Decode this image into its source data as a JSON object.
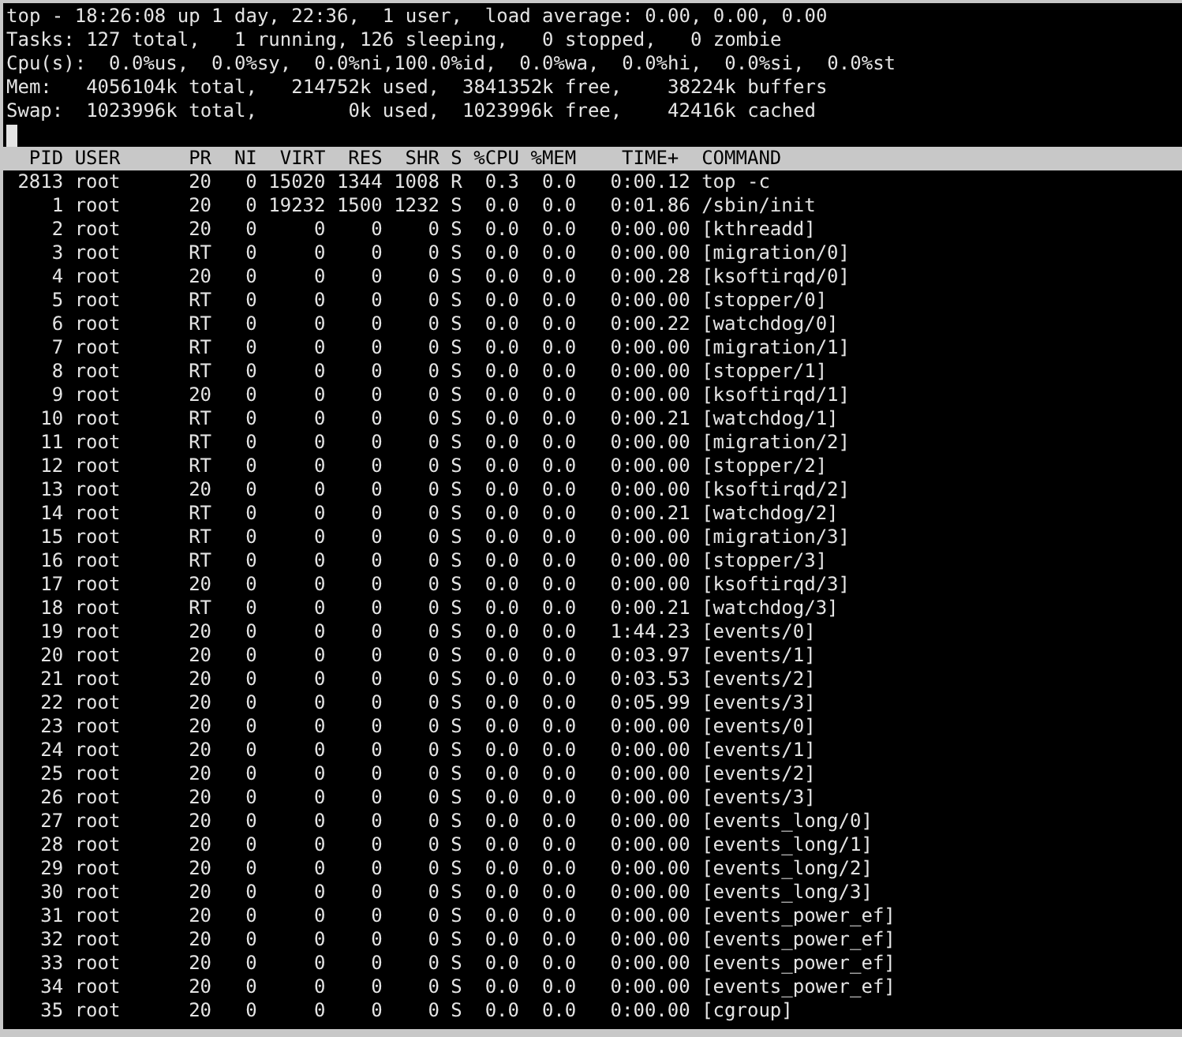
{
  "summary": [
    "top - 18:26:08 up 1 day, 22:36,  1 user,  load average: 0.00, 0.00, 0.00",
    "Tasks: 127 total,   1 running, 126 sleeping,   0 stopped,   0 zombie",
    "Cpu(s):  0.0%us,  0.0%sy,  0.0%ni,100.0%id,  0.0%wa,  0.0%hi,  0.0%si,  0.0%st",
    "Mem:   4056104k total,   214752k used,  3841352k free,    38224k buffers",
    "Swap:  1023996k total,        0k used,  1023996k free,    42416k cached"
  ],
  "columns": [
    "PID",
    "USER",
    "PR",
    "NI",
    "VIRT",
    "RES",
    "SHR",
    "S",
    "%CPU",
    "%MEM",
    "TIME+",
    "COMMAND"
  ],
  "processes": [
    [
      "2813",
      "root",
      "20",
      "0",
      "15020",
      "1344",
      "1008",
      "R",
      "0.3",
      "0.0",
      "0:00.12",
      "top -c"
    ],
    [
      "1",
      "root",
      "20",
      "0",
      "19232",
      "1500",
      "1232",
      "S",
      "0.0",
      "0.0",
      "0:01.86",
      "/sbin/init"
    ],
    [
      "2",
      "root",
      "20",
      "0",
      "0",
      "0",
      "0",
      "S",
      "0.0",
      "0.0",
      "0:00.00",
      "[kthreadd]"
    ],
    [
      "3",
      "root",
      "RT",
      "0",
      "0",
      "0",
      "0",
      "S",
      "0.0",
      "0.0",
      "0:00.00",
      "[migration/0]"
    ],
    [
      "4",
      "root",
      "20",
      "0",
      "0",
      "0",
      "0",
      "S",
      "0.0",
      "0.0",
      "0:00.28",
      "[ksoftirqd/0]"
    ],
    [
      "5",
      "root",
      "RT",
      "0",
      "0",
      "0",
      "0",
      "S",
      "0.0",
      "0.0",
      "0:00.00",
      "[stopper/0]"
    ],
    [
      "6",
      "root",
      "RT",
      "0",
      "0",
      "0",
      "0",
      "S",
      "0.0",
      "0.0",
      "0:00.22",
      "[watchdog/0]"
    ],
    [
      "7",
      "root",
      "RT",
      "0",
      "0",
      "0",
      "0",
      "S",
      "0.0",
      "0.0",
      "0:00.00",
      "[migration/1]"
    ],
    [
      "8",
      "root",
      "RT",
      "0",
      "0",
      "0",
      "0",
      "S",
      "0.0",
      "0.0",
      "0:00.00",
      "[stopper/1]"
    ],
    [
      "9",
      "root",
      "20",
      "0",
      "0",
      "0",
      "0",
      "S",
      "0.0",
      "0.0",
      "0:00.00",
      "[ksoftirqd/1]"
    ],
    [
      "10",
      "root",
      "RT",
      "0",
      "0",
      "0",
      "0",
      "S",
      "0.0",
      "0.0",
      "0:00.21",
      "[watchdog/1]"
    ],
    [
      "11",
      "root",
      "RT",
      "0",
      "0",
      "0",
      "0",
      "S",
      "0.0",
      "0.0",
      "0:00.00",
      "[migration/2]"
    ],
    [
      "12",
      "root",
      "RT",
      "0",
      "0",
      "0",
      "0",
      "S",
      "0.0",
      "0.0",
      "0:00.00",
      "[stopper/2]"
    ],
    [
      "13",
      "root",
      "20",
      "0",
      "0",
      "0",
      "0",
      "S",
      "0.0",
      "0.0",
      "0:00.00",
      "[ksoftirqd/2]"
    ],
    [
      "14",
      "root",
      "RT",
      "0",
      "0",
      "0",
      "0",
      "S",
      "0.0",
      "0.0",
      "0:00.21",
      "[watchdog/2]"
    ],
    [
      "15",
      "root",
      "RT",
      "0",
      "0",
      "0",
      "0",
      "S",
      "0.0",
      "0.0",
      "0:00.00",
      "[migration/3]"
    ],
    [
      "16",
      "root",
      "RT",
      "0",
      "0",
      "0",
      "0",
      "S",
      "0.0",
      "0.0",
      "0:00.00",
      "[stopper/3]"
    ],
    [
      "17",
      "root",
      "20",
      "0",
      "0",
      "0",
      "0",
      "S",
      "0.0",
      "0.0",
      "0:00.00",
      "[ksoftirqd/3]"
    ],
    [
      "18",
      "root",
      "RT",
      "0",
      "0",
      "0",
      "0",
      "S",
      "0.0",
      "0.0",
      "0:00.21",
      "[watchdog/3]"
    ],
    [
      "19",
      "root",
      "20",
      "0",
      "0",
      "0",
      "0",
      "S",
      "0.0",
      "0.0",
      "1:44.23",
      "[events/0]"
    ],
    [
      "20",
      "root",
      "20",
      "0",
      "0",
      "0",
      "0",
      "S",
      "0.0",
      "0.0",
      "0:03.97",
      "[events/1]"
    ],
    [
      "21",
      "root",
      "20",
      "0",
      "0",
      "0",
      "0",
      "S",
      "0.0",
      "0.0",
      "0:03.53",
      "[events/2]"
    ],
    [
      "22",
      "root",
      "20",
      "0",
      "0",
      "0",
      "0",
      "S",
      "0.0",
      "0.0",
      "0:05.99",
      "[events/3]"
    ],
    [
      "23",
      "root",
      "20",
      "0",
      "0",
      "0",
      "0",
      "S",
      "0.0",
      "0.0",
      "0:00.00",
      "[events/0]"
    ],
    [
      "24",
      "root",
      "20",
      "0",
      "0",
      "0",
      "0",
      "S",
      "0.0",
      "0.0",
      "0:00.00",
      "[events/1]"
    ],
    [
      "25",
      "root",
      "20",
      "0",
      "0",
      "0",
      "0",
      "S",
      "0.0",
      "0.0",
      "0:00.00",
      "[events/2]"
    ],
    [
      "26",
      "root",
      "20",
      "0",
      "0",
      "0",
      "0",
      "S",
      "0.0",
      "0.0",
      "0:00.00",
      "[events/3]"
    ],
    [
      "27",
      "root",
      "20",
      "0",
      "0",
      "0",
      "0",
      "S",
      "0.0",
      "0.0",
      "0:00.00",
      "[events_long/0]"
    ],
    [
      "28",
      "root",
      "20",
      "0",
      "0",
      "0",
      "0",
      "S",
      "0.0",
      "0.0",
      "0:00.00",
      "[events_long/1]"
    ],
    [
      "29",
      "root",
      "20",
      "0",
      "0",
      "0",
      "0",
      "S",
      "0.0",
      "0.0",
      "0:00.00",
      "[events_long/2]"
    ],
    [
      "30",
      "root",
      "20",
      "0",
      "0",
      "0",
      "0",
      "S",
      "0.0",
      "0.0",
      "0:00.00",
      "[events_long/3]"
    ],
    [
      "31",
      "root",
      "20",
      "0",
      "0",
      "0",
      "0",
      "S",
      "0.0",
      "0.0",
      "0:00.00",
      "[events_power_ef]"
    ],
    [
      "32",
      "root",
      "20",
      "0",
      "0",
      "0",
      "0",
      "S",
      "0.0",
      "0.0",
      "0:00.00",
      "[events_power_ef]"
    ],
    [
      "33",
      "root",
      "20",
      "0",
      "0",
      "0",
      "0",
      "S",
      "0.0",
      "0.0",
      "0:00.00",
      "[events_power_ef]"
    ],
    [
      "34",
      "root",
      "20",
      "0",
      "0",
      "0",
      "0",
      "S",
      "0.0",
      "0.0",
      "0:00.00",
      "[events_power_ef]"
    ],
    [
      "35",
      "root",
      "20",
      "0",
      "0",
      "0",
      "0",
      "S",
      "0.0",
      "0.0",
      "0:00.00",
      "[cgroup]"
    ]
  ]
}
